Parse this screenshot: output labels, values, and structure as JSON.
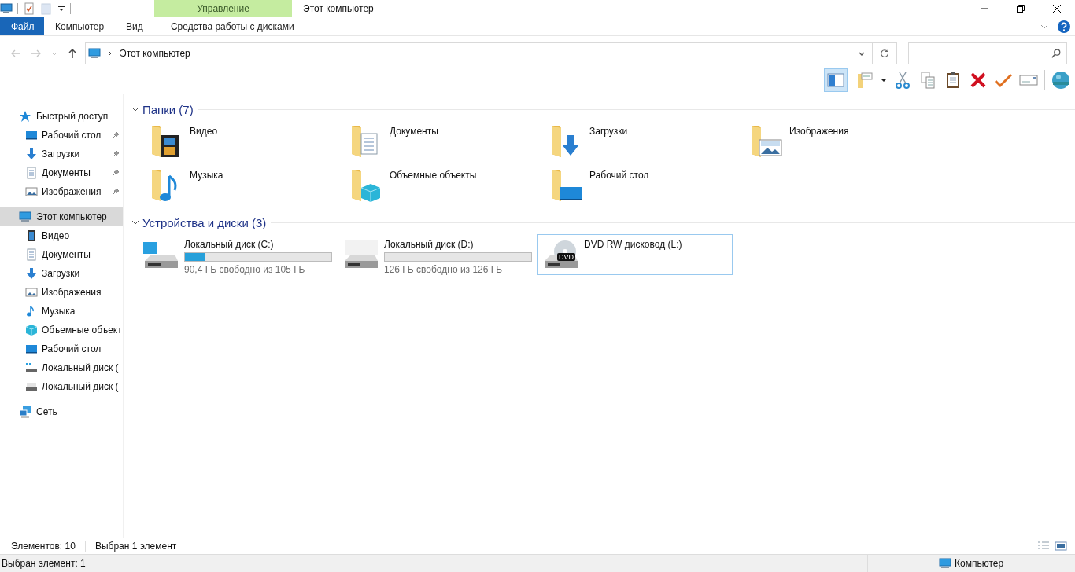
{
  "window": {
    "title": "Этот компьютер",
    "context_group": "Управление"
  },
  "ribbon_tabs": [
    {
      "label": "Файл",
      "kind": "file",
      "selected": false
    },
    {
      "label": "Компьютер",
      "kind": "normal",
      "selected": false
    },
    {
      "label": "Вид",
      "kind": "normal",
      "selected": false
    },
    {
      "label": "Средства работы с дисками",
      "kind": "context",
      "selected": false
    }
  ],
  "address_bar": {
    "path": "Этот компьютер"
  },
  "toolbar": {
    "pane_toggle": {
      "on": true
    }
  },
  "sidebar": {
    "items": [
      {
        "label": "Быстрый доступ",
        "kind": "star",
        "selected": false,
        "children": [
          {
            "label": "Рабочий стол",
            "kind": "desktop",
            "pinned": true,
            "selected": false
          },
          {
            "label": "Загрузки",
            "kind": "downloads",
            "pinned": true,
            "selected": false
          },
          {
            "label": "Документы",
            "kind": "documents",
            "pinned": true,
            "selected": false
          },
          {
            "label": "Изображения",
            "kind": "pictures",
            "pinned": true,
            "selected": false
          }
        ]
      },
      {
        "label": "Этот компьютер",
        "kind": "computer",
        "selected": true,
        "children": [
          {
            "label": "Видео",
            "kind": "video",
            "pinned": false,
            "selected": false
          },
          {
            "label": "Документы",
            "kind": "documents",
            "pinned": false,
            "selected": false
          },
          {
            "label": "Загрузки",
            "kind": "downloads",
            "pinned": false,
            "selected": false
          },
          {
            "label": "Изображения",
            "kind": "pictures",
            "pinned": false,
            "selected": false
          },
          {
            "label": "Музыка",
            "kind": "music",
            "pinned": false,
            "selected": false
          },
          {
            "label": "Объемные объект",
            "kind": "objects",
            "pinned": false,
            "selected": false
          },
          {
            "label": "Рабочий стол",
            "kind": "desktop",
            "pinned": false,
            "selected": false
          },
          {
            "label": "Локальный диск (",
            "kind": "windrive",
            "pinned": false,
            "selected": false
          },
          {
            "label": "Локальный диск (",
            "kind": "drive",
            "pinned": false,
            "selected": false
          }
        ]
      },
      {
        "label": "Сеть",
        "kind": "network",
        "selected": false
      }
    ]
  },
  "folders_group": {
    "title": "Папки (7)",
    "expanded": true,
    "items": [
      {
        "name": "Видео",
        "kind": "video"
      },
      {
        "name": "Документы",
        "kind": "documents"
      },
      {
        "name": "Загрузки",
        "kind": "downloads"
      },
      {
        "name": "Изображения",
        "kind": "pictures"
      },
      {
        "name": "Музыка",
        "kind": "music"
      },
      {
        "name": "Объемные объекты",
        "kind": "objects"
      },
      {
        "name": "Рабочий стол",
        "kind": "desktop"
      }
    ]
  },
  "drives_group": {
    "title": "Устройства и диски (3)",
    "expanded": true,
    "items": [
      {
        "name": "Локальный диск (C:)",
        "kind": "windows",
        "level": 0.14,
        "free": "90,4 ГБ свободно из 105 ГБ",
        "selected": false
      },
      {
        "name": "Локальный диск (D:)",
        "kind": "plain",
        "free": "126 ГБ свободно из 126 ГБ",
        "selected": false
      },
      {
        "name": "DVD RW дисковод (L:)",
        "kind": "dvd",
        "badge": "DVD",
        "selected": true
      }
    ]
  },
  "status_bar": {
    "count": "Элементов: 10",
    "selection": "Выбран 1 элемент"
  },
  "bottom_bar": {
    "left": "Выбран элемент: 1",
    "right": "Компьютер"
  }
}
